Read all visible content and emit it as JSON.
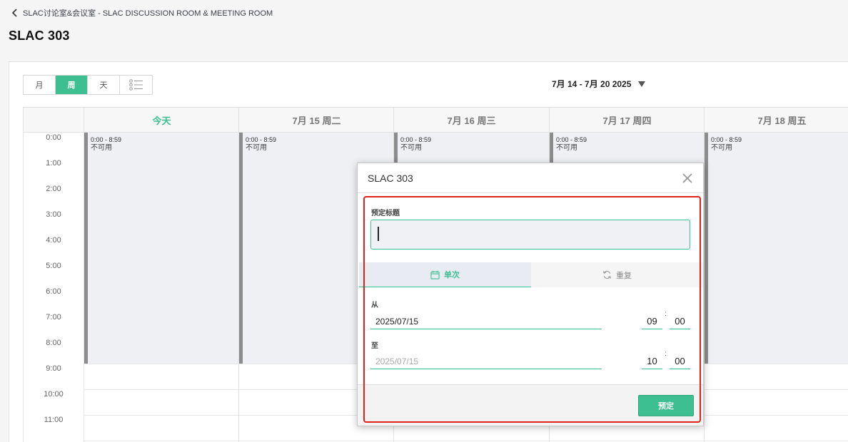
{
  "header": {
    "back_label": "SLAC讨论室&会议室 - SLAC DISCUSSION ROOM & MEETING ROOM",
    "title": "SLAC 303"
  },
  "toolbar": {
    "views": [
      "月",
      "周",
      "天"
    ],
    "active_view": "周",
    "list_icon": "list-icon",
    "date_range": "7月 14 - 7月 20 2025"
  },
  "calendar": {
    "days": [
      "今天",
      "7月 15 周二",
      "7月 16 周三",
      "7月 17 周四",
      "7月 18 周五"
    ],
    "times": [
      "0:00",
      "1:00",
      "2:00",
      "3:00",
      "4:00",
      "5:00",
      "6:00",
      "7:00",
      "8:00",
      "9:00",
      "10:00",
      "11:00"
    ],
    "unavailable": {
      "time": "0:00 - 8:59",
      "label": "不可用"
    }
  },
  "modal": {
    "title": "SLAC 303",
    "booking_title_label": "预定标题",
    "booking_title_value": "",
    "tabs": [
      {
        "label": "单次",
        "icon": "calendar-icon",
        "active": true
      },
      {
        "label": "重复",
        "icon": "repeat-icon",
        "active": false
      }
    ],
    "from": {
      "label": "从",
      "date": "2025/07/15",
      "hour": "09",
      "minute": "00"
    },
    "to": {
      "label": "至",
      "date": "2025/07/15",
      "hour": "10",
      "minute": "00"
    },
    "submit_label": "预定"
  },
  "colors": {
    "accent": "#3dbf91",
    "highlight": "#e0221b"
  }
}
